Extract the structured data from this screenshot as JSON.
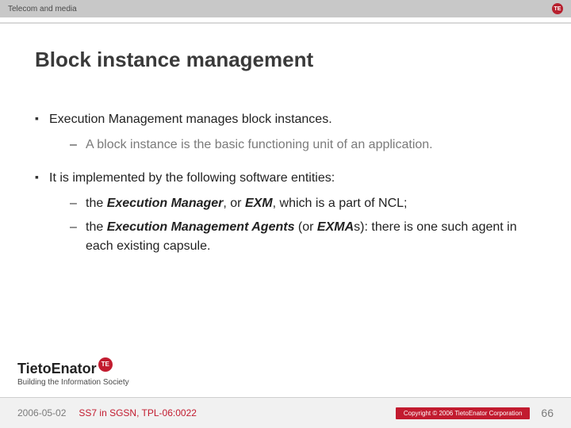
{
  "header": {
    "category": "Telecom and media",
    "badge": "TE"
  },
  "title": "Block instance management",
  "bullets": [
    {
      "text": "Execution Management manages block instances.",
      "sub": [
        {
          "html": "A block instance is the basic functioning unit of an application.",
          "grey": true
        }
      ]
    },
    {
      "text": "It is implemented by the following software entities:",
      "sub": [
        {
          "html": "the <b><i>Execution Manager</i></b>, or <b><i>EXM</i></b>, which is a part of NCL;"
        },
        {
          "html": "the <b><i>Execution Management Agents</i></b> (or <b><i>EXMA</i></b>s): there is one such agent in each existing capsule."
        }
      ]
    }
  ],
  "logo": {
    "name": "TietoEnator",
    "dot": "TE",
    "tagline": "Building the Information Society"
  },
  "footer": {
    "date": "2006-05-02",
    "doc": "SS7 in SGSN, TPL-06:0022",
    "copyright": "Copyright © 2006 TietoEnator Corporation",
    "page": "66"
  }
}
